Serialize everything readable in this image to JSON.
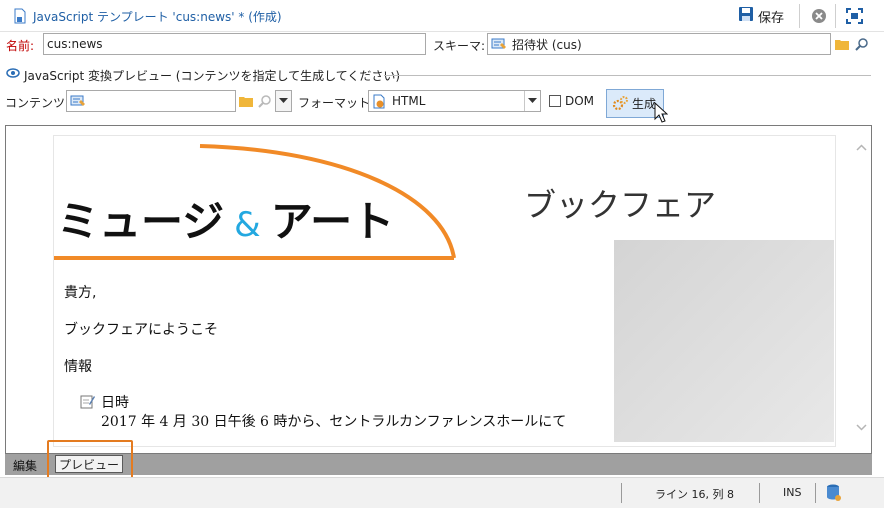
{
  "window": {
    "title": "JavaScript テンプレート 'cus:news' * (作成)",
    "save_label": "保存"
  },
  "form": {
    "name_label": "名前:",
    "name_value": "cus:news",
    "schema_label": "スキーマ:",
    "schema_value": "招待状 (cus)"
  },
  "preview_group": {
    "title": "JavaScript 変換プレビュー (コンテンツを指定して生成してください)",
    "content_label": "コンテンツ:",
    "content_value": "",
    "format_label": "フォーマット:",
    "format_value": "HTML",
    "dom_label": "DOM",
    "dom_checked": false,
    "generate_label": "生成"
  },
  "document": {
    "logo_left": "ミュージ",
    "logo_amp": "&",
    "logo_right": "アート",
    "heading": "ブックフェア",
    "greeting": "貴方,",
    "welcome": "ブックフェアにようこそ",
    "info_heading": "情報",
    "date_label": "日時",
    "date_detail": "2017 年 4 月 30 日午後 6 時から、セントラルカンファレンスホールにて"
  },
  "tabs": {
    "edit": "編集",
    "preview": "プレビュー"
  },
  "status": {
    "position": "ライン 16, 列 8",
    "mode": "INS"
  },
  "colors": {
    "accent_orange": "#e47b20",
    "link_blue": "#1f5fa5",
    "label_red": "#c00000"
  }
}
